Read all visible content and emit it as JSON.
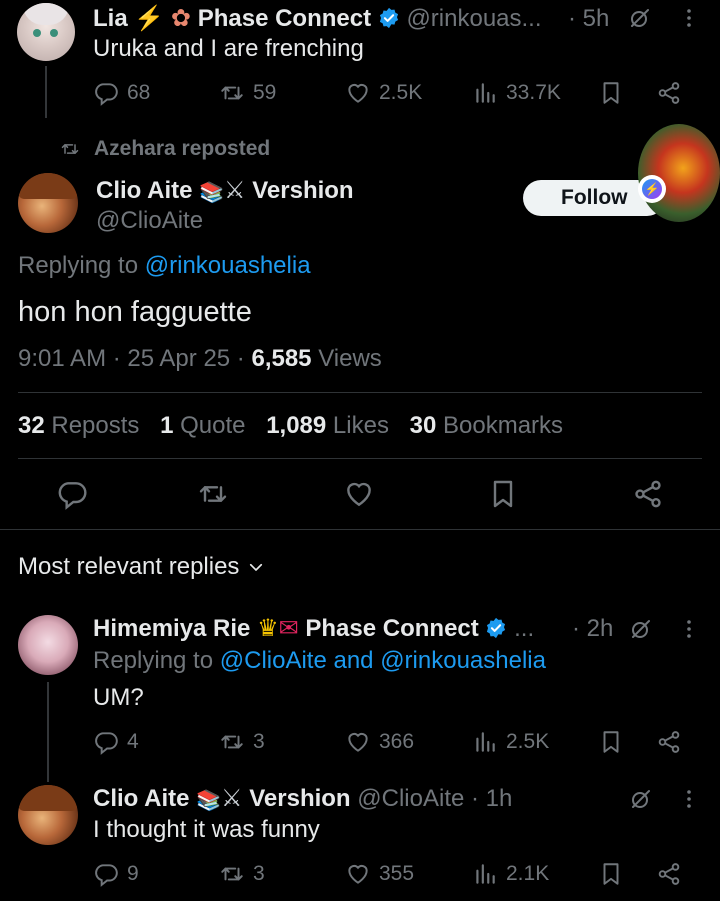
{
  "post1": {
    "name": "Lia",
    "name_suffix": "Phase Connect",
    "handle": "@rinkouas...",
    "time": "· 5h",
    "text": "Uruka and I are frenching",
    "replies": "68",
    "reposts": "59",
    "likes": "2.5K",
    "views": "33.7K"
  },
  "repost_banner": "Azehara reposted",
  "main": {
    "name": "Clio Aite",
    "name_suffix": "Vershion",
    "handle": "@ClioAite",
    "follow_label": "Follow",
    "replying_prefix": "Replying to",
    "replying_to": "@rinkouashelia",
    "text": "hon hon fagguette",
    "time": "9:01 AM · 25 Apr 25 ·",
    "views_count": "6,585",
    "views_label": "Views",
    "stats": {
      "reposts_count": "32",
      "reposts_label": "Reposts",
      "quote_count": "1",
      "quote_label": "Quote",
      "likes_count": "1,089",
      "likes_label": "Likes",
      "bookmarks_count": "30",
      "bookmarks_label": "Bookmarks"
    }
  },
  "replies_header": "Most relevant replies",
  "reply1": {
    "name": "Himemiya Rie",
    "name_suffix": "Phase Connect",
    "ellipsis": "...",
    "time": "· 2h",
    "replying_prefix": "Replying to",
    "replying_to": "@ClioAite and @rinkouashelia",
    "text": "UM?",
    "replies": "4",
    "reposts": "3",
    "likes": "366",
    "views": "2.5K"
  },
  "reply2": {
    "name": "Clio Aite",
    "name_suffix": "Vershion",
    "handle": "@ClioAite",
    "time": "· 1h",
    "text": "I thought it was funny",
    "replies": "9",
    "reposts": "3",
    "likes": "355",
    "views": "2.1K"
  },
  "colors": {
    "accent": "#1d9bf0",
    "muted": "#71767b",
    "background": "#000000",
    "divider": "#2f3336"
  }
}
